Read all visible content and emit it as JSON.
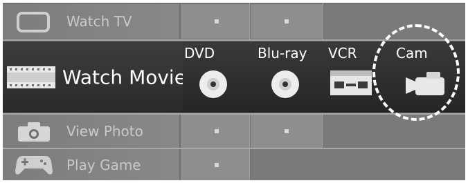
{
  "menu": {
    "rows": [
      {
        "label": "Watch TV",
        "icon": "tv-icon"
      },
      {
        "label": "Watch Movie",
        "icon": "film-strip-icon",
        "selected": true
      },
      {
        "label": "View Photo",
        "icon": "camera-icon"
      },
      {
        "label": "Play Game",
        "icon": "gamepad-icon"
      }
    ],
    "movie_options": [
      {
        "label": "DVD",
        "icon": "disc-icon"
      },
      {
        "label": "Blu-ray",
        "icon": "disc-icon"
      },
      {
        "label": "VCR",
        "icon": "vcr-cassette-icon"
      },
      {
        "label": "Cam",
        "icon": "camcorder-icon",
        "highlighted": true
      }
    ]
  },
  "colors": {
    "selected_row": "#2f2f2f",
    "unselected_row": "#8a8a8a",
    "highlight_ring": "#ffffff"
  }
}
